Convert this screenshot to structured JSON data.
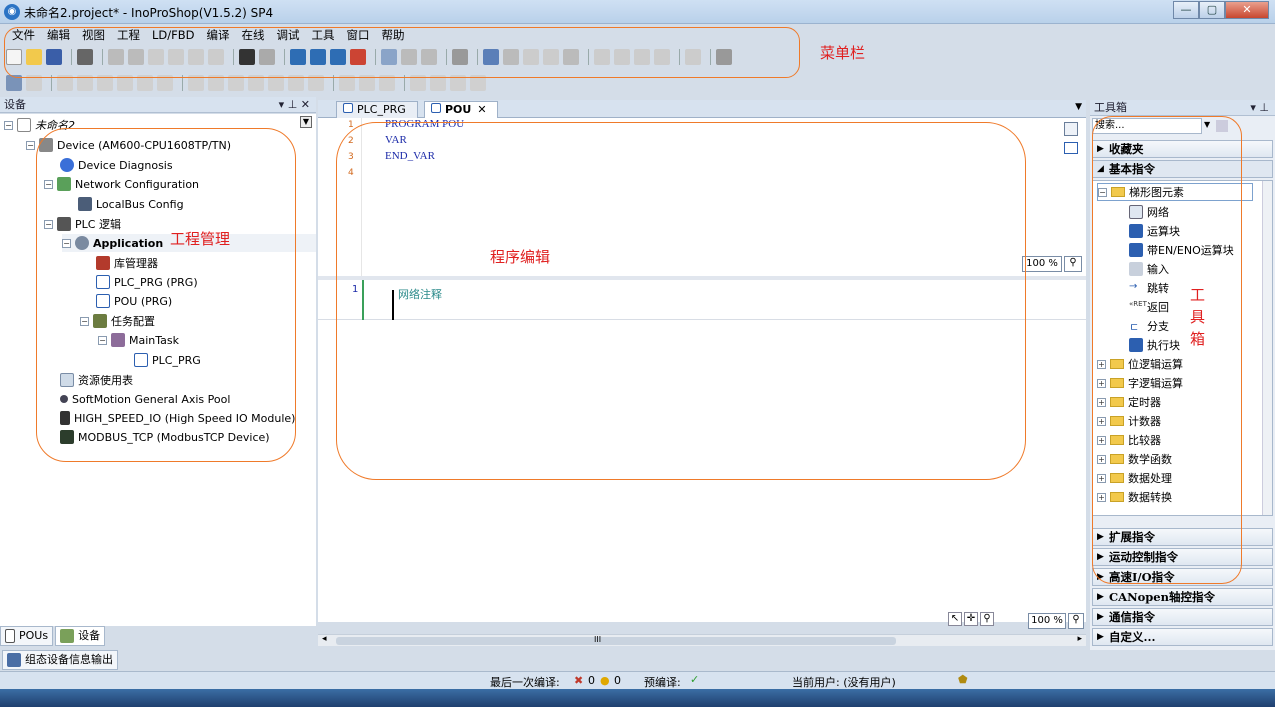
{
  "window": {
    "title": "未命名2.project* - InoProShop(V1.5.2) SP4",
    "app_icon": "app-icon",
    "buttons": {
      "minimize": "—",
      "maximize": "▢",
      "close": "✕"
    }
  },
  "menu": [
    "文件",
    "编辑",
    "视图",
    "工程",
    "LD/FBD",
    "编译",
    "在线",
    "调试",
    "工具",
    "窗口",
    "帮助"
  ],
  "annotations": {
    "menu": "菜单栏",
    "project": "工程管理",
    "editor": "程序编辑",
    "toolbox": [
      "工",
      "具",
      "箱"
    ]
  },
  "devices_panel": {
    "title": "设备",
    "pin": "▾ ⊥ ✕",
    "root": "未命名2",
    "nodes": [
      {
        "label": "Device (AM600-CPU1608TP/TN)",
        "icon": "plc-device-icon"
      },
      {
        "label": "Device Diagnosis",
        "icon": "diagnosis-icon"
      },
      {
        "label": "Network Configuration",
        "icon": "network-icon"
      },
      {
        "label": "LocalBus Config",
        "icon": "bus-icon"
      },
      {
        "label": "PLC 逻辑",
        "icon": "plc-logic-icon"
      },
      {
        "label": "Application",
        "icon": "application-gear-icon"
      },
      {
        "label": "库管理器",
        "icon": "library-icon"
      },
      {
        "label": "PLC_PRG (PRG)",
        "icon": "program-icon"
      },
      {
        "label": "POU (PRG)",
        "icon": "pou-icon"
      },
      {
        "label": "任务配置",
        "icon": "task-config-icon"
      },
      {
        "label": "MainTask",
        "icon": "task-icon"
      },
      {
        "label": "PLC_PRG",
        "icon": "program-call-icon"
      },
      {
        "label": "资源使用表",
        "icon": "resource-table-icon"
      },
      {
        "label": "SoftMotion General Axis Pool",
        "icon": "axis-pool-icon"
      },
      {
        "label": "HIGH_SPEED_IO (High Speed IO Module)",
        "icon": "io-module-icon"
      },
      {
        "label": "MODBUS_TCP (ModbusTCP Device)",
        "icon": "modbus-icon"
      }
    ],
    "bottom_tabs": [
      "POUs",
      "设备"
    ]
  },
  "editor": {
    "tabs": [
      "PLC_PRG",
      "POU"
    ],
    "code_lines": [
      "PROGRAM POU",
      "VAR",
      "END_VAR",
      ""
    ],
    "line_numbers": [
      "1",
      "2",
      "3",
      "4"
    ],
    "zoom": "100 %",
    "ladder": {
      "network_number": "1",
      "network_comment": "网络注释"
    },
    "scroll_label": "III",
    "bottom_zoom": "100 %"
  },
  "toolbox": {
    "title": "工具箱",
    "search_placeholder": "搜索...",
    "sections_top": [
      "收藏夹",
      "基本指令"
    ],
    "tree": {
      "root": "梯形图元素",
      "children": [
        "网络",
        "运算块",
        "带EN/ENO运算块",
        "输入",
        "跳转",
        "返回",
        "分支",
        "执行块"
      ],
      "folders": [
        "位逻辑运算",
        "字逻辑运算",
        "定时器",
        "计数器",
        "比较器",
        "数学函数",
        "数据处理",
        "数据转换"
      ]
    },
    "sections_bottom": [
      "扩展指令",
      "运动控制指令",
      "高速I/O指令",
      "CANopen轴控指令",
      "通信指令",
      "自定义..."
    ]
  },
  "output_tab": "组态设备信息输出",
  "status": {
    "last_compile_label": "最后一次编译:",
    "errors": "0",
    "warnings": "0",
    "precompile_label": "预编译:",
    "precompile_ok": "✓",
    "user_label": "当前用户: (没有用户)"
  },
  "colors": {
    "accent": "#ef7a2a",
    "annotation_text": "#e02020",
    "keyword": "#1b2aa8",
    "line_number": "#d2691e"
  }
}
